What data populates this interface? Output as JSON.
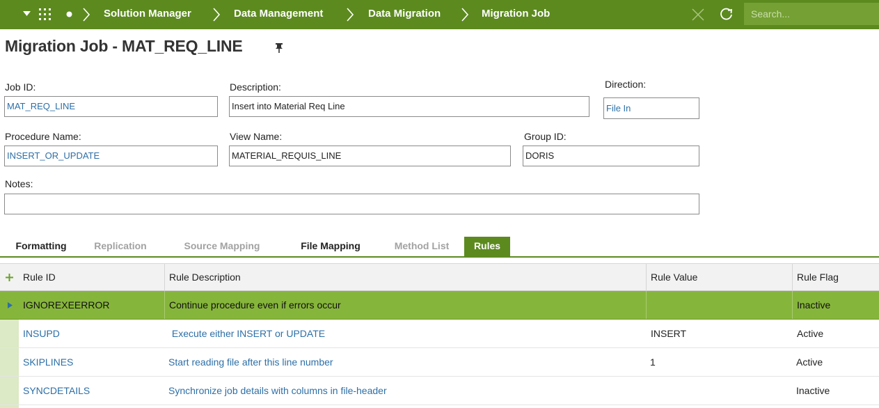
{
  "header": {
    "breadcrumbs": [
      "Solution Manager",
      "Data Management",
      "Data Migration",
      "Migration Job"
    ],
    "search_placeholder": "Search..."
  },
  "page": {
    "title": "Migration Job - MAT_REQ_LINE"
  },
  "form": {
    "job_id": {
      "label": "Job ID:",
      "value": "MAT_REQ_LINE"
    },
    "description": {
      "label": "Description:",
      "value": "Insert into Material Req Line"
    },
    "direction": {
      "label": "Direction:",
      "value": "File In"
    },
    "procedure_name": {
      "label": "Procedure Name:",
      "value": "INSERT_OR_UPDATE"
    },
    "view_name": {
      "label": "View Name:",
      "value": "MATERIAL_REQUIS_LINE"
    },
    "group_id": {
      "label": "Group ID:",
      "value": "DORIS"
    },
    "notes": {
      "label": "Notes:",
      "value": ""
    }
  },
  "tabs": [
    {
      "label": "Formatting",
      "state": "enabled"
    },
    {
      "label": "Replication",
      "state": "disabled"
    },
    {
      "label": "Source Mapping",
      "state": "disabled"
    },
    {
      "label": "File Mapping",
      "state": "enabled"
    },
    {
      "label": "Method List",
      "state": "disabled"
    },
    {
      "label": "Rules",
      "state": "active"
    }
  ],
  "table": {
    "columns": [
      "Rule ID",
      "Rule Description",
      "Rule Value",
      "Rule Flag"
    ],
    "rows": [
      {
        "id": "IGNOREXEERROR",
        "desc": "Continue procedure even if errors occur",
        "value": "",
        "flag": "Inactive",
        "selected": true
      },
      {
        "id": "INSUPD",
        "desc": " Execute either INSERT or UPDATE",
        "value": "INSERT",
        "flag": "Active",
        "selected": false
      },
      {
        "id": "SKIPLINES",
        "desc": "Start reading file after this line number",
        "value": "1",
        "flag": "Active",
        "selected": false
      },
      {
        "id": "SYNCDETAILS",
        "desc": "Synchronize job details with columns in file-header",
        "value": "",
        "flag": "Inactive",
        "selected": false
      }
    ]
  },
  "colors": {
    "brand_green": "#5c8a1f",
    "selected_row": "#86b53b",
    "link_blue": "#2d6fa6"
  },
  "icons": [
    "chevron-down-icon",
    "app-grid-icon",
    "dot-icon",
    "breadcrumb-separator-icon",
    "close-icon",
    "refresh-icon",
    "pin-icon",
    "add-icon",
    "row-indicator-icon"
  ]
}
